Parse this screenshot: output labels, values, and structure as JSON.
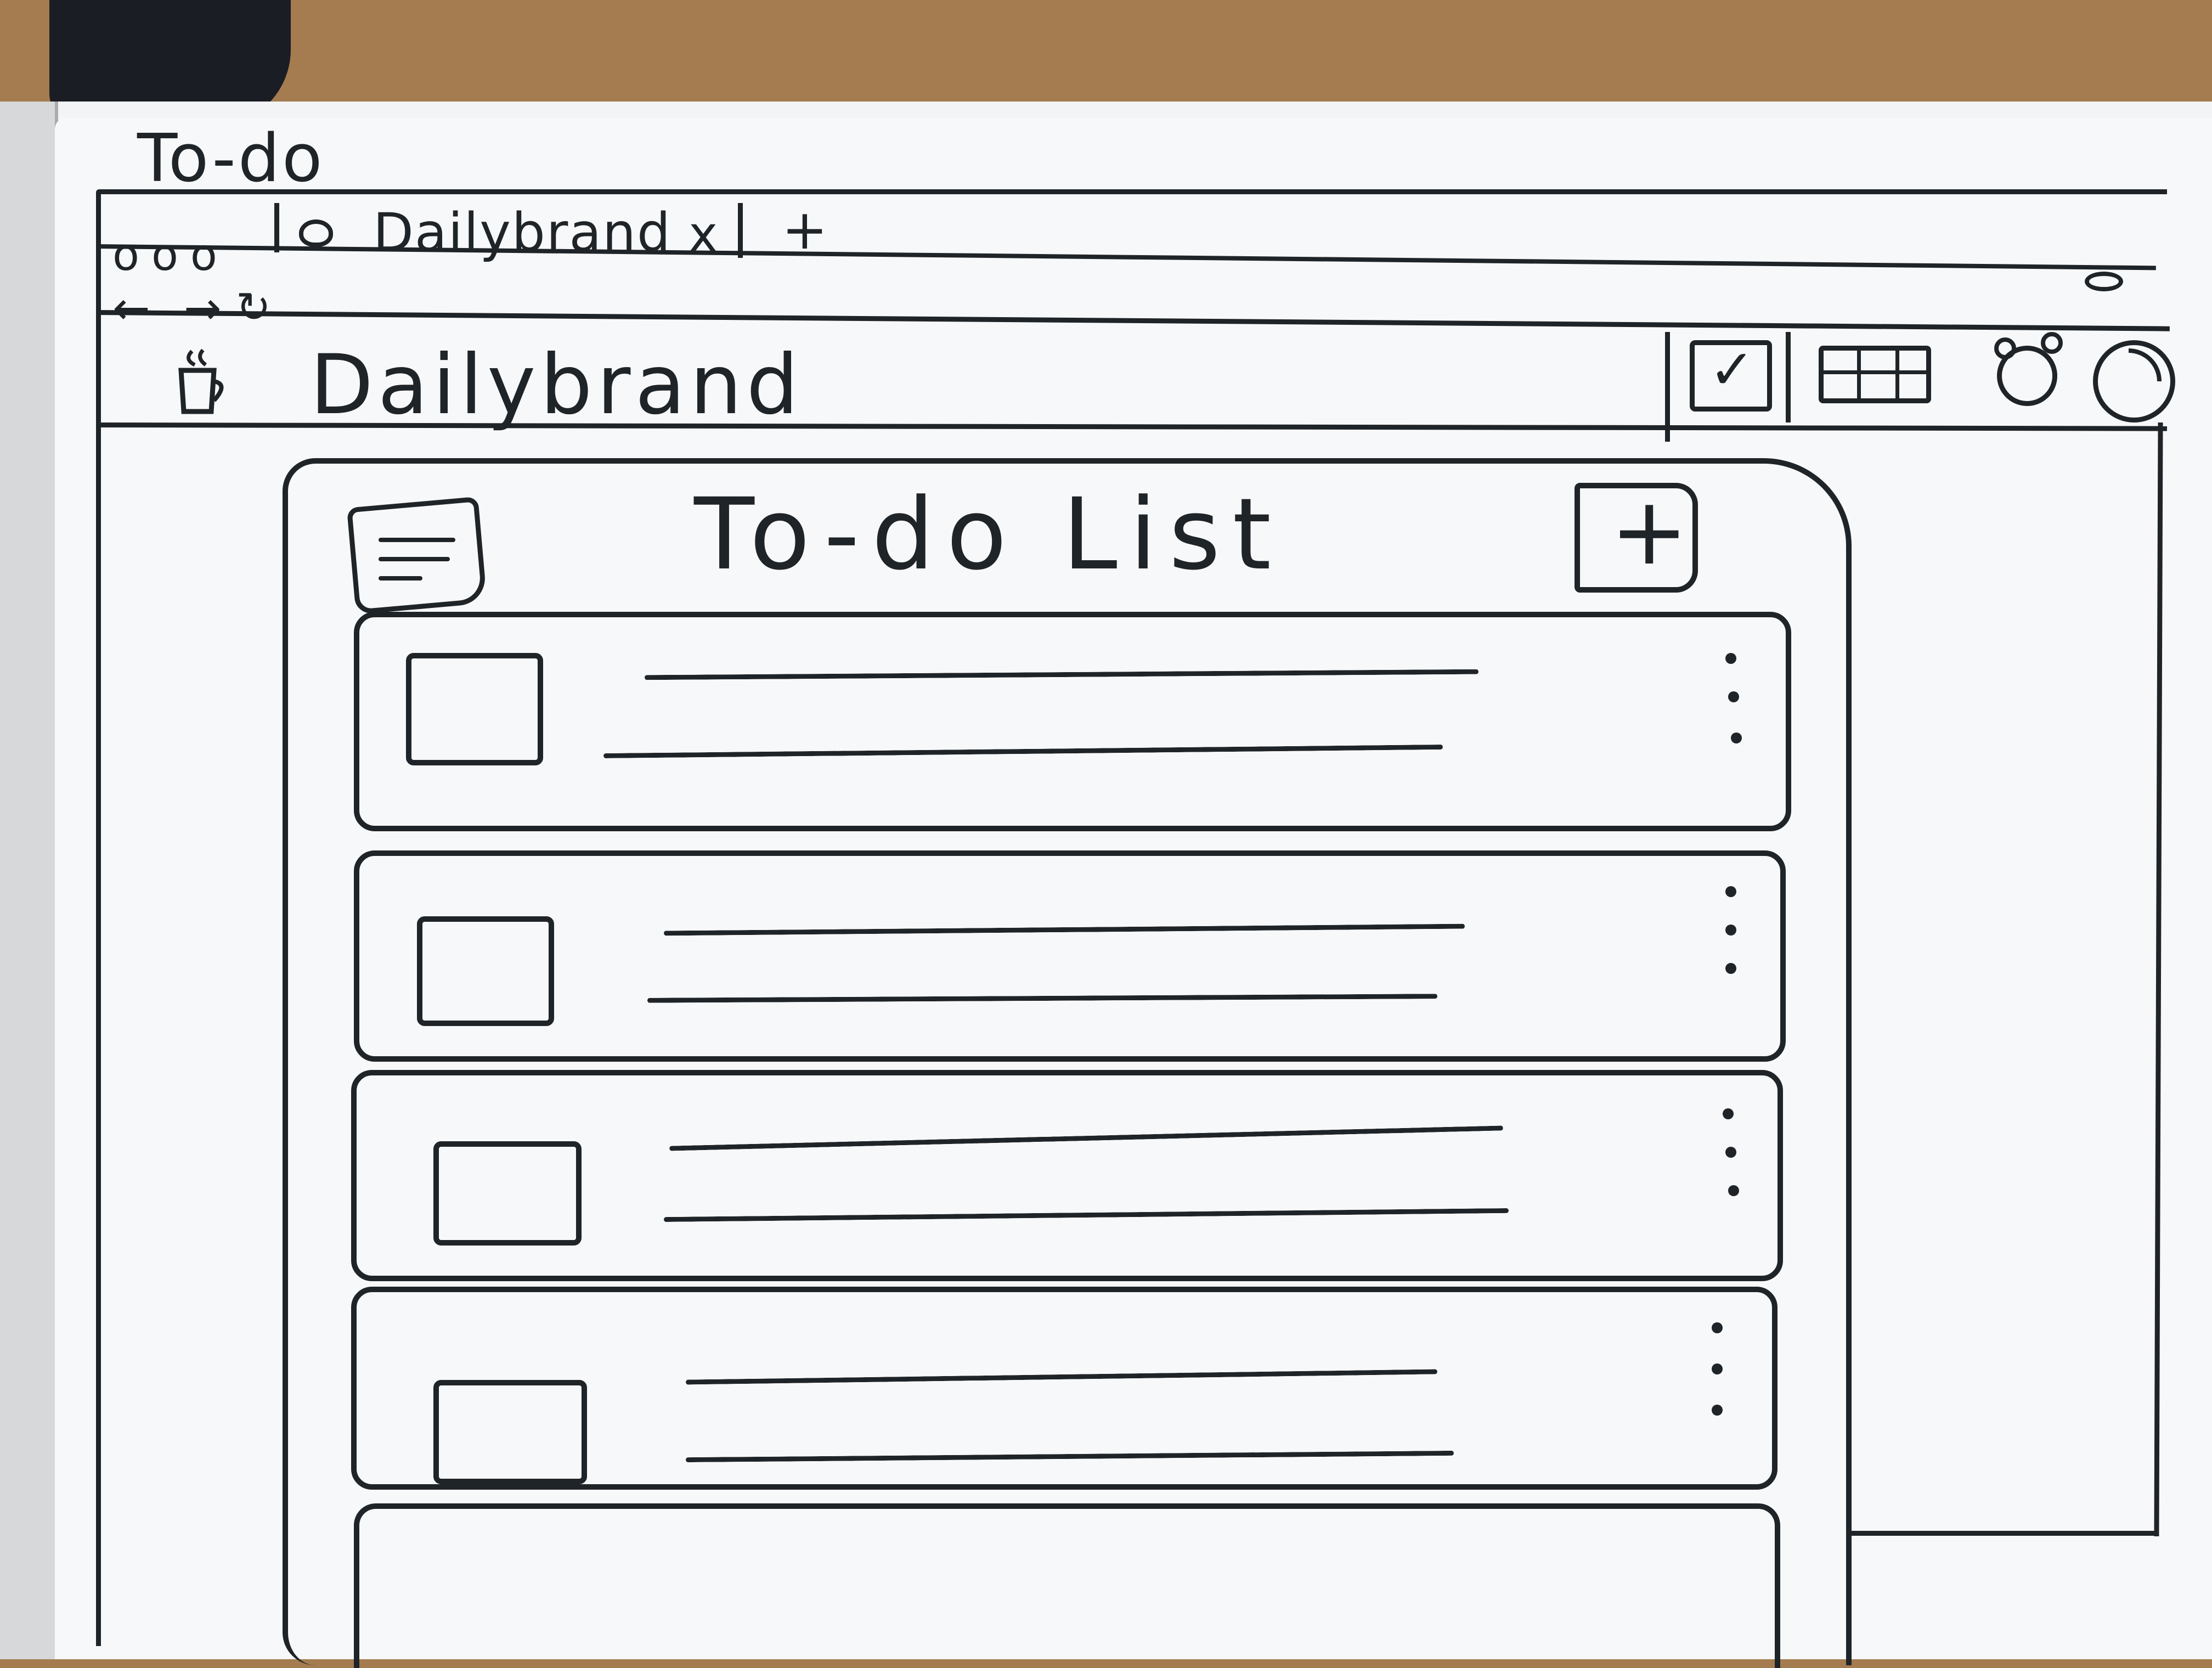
{
  "sketch_title": "To-do",
  "browser": {
    "window_controls": "ooo",
    "tab": {
      "title": "Dailybrand",
      "close": "x"
    },
    "new_tab": "+",
    "nav": {
      "back": "←",
      "forward": "→",
      "reload": "↻"
    }
  },
  "app": {
    "name": "Dailybrand",
    "nav_icons": [
      "checkbox-icon",
      "calendar-icon",
      "alarm-clock-icon",
      "stats-chart-icon"
    ],
    "check_glyph": "✓"
  },
  "todo_panel": {
    "title": "To-do List",
    "add_glyph": "+"
  },
  "tasks": [
    {
      "checked": false
    },
    {
      "checked": false
    },
    {
      "checked": false
    },
    {
      "checked": false
    },
    {
      "checked": false
    }
  ],
  "colors": {
    "ink": "#1f2428",
    "paper": "#f7f8f9",
    "desk": "#a57c4f"
  }
}
